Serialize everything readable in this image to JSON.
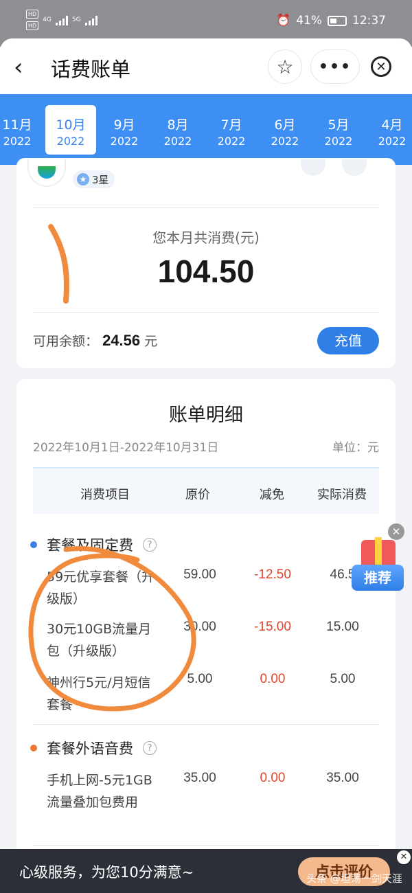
{
  "status_bar": {
    "hd1": "HD",
    "hd2": "HD",
    "net1": "4G",
    "net2": "5G",
    "battery": "41%",
    "time": "12:37"
  },
  "header": {
    "back_glyph": "‹",
    "title": "话费账单",
    "star_glyph": "☆",
    "more_glyph": "•••",
    "close_glyph": "✕"
  },
  "months": [
    {
      "month": "11月",
      "year": "2022"
    },
    {
      "month": "10月",
      "year": "2022",
      "active": true
    },
    {
      "month": "9月",
      "year": "2022"
    },
    {
      "month": "8月",
      "year": "2022"
    },
    {
      "month": "7月",
      "year": "2022"
    },
    {
      "month": "6月",
      "year": "2022"
    },
    {
      "month": "5月",
      "year": "2022"
    },
    {
      "month": "4月",
      "year": "2022"
    }
  ],
  "summary": {
    "star_level": "3星",
    "total_label": "您本月共消费(元)",
    "total_value": "104.50",
    "balance_label": "可用余额：",
    "balance_value": "24.56",
    "balance_unit": "元",
    "recharge_label": "充值"
  },
  "detail": {
    "title": "账单明细",
    "period": "2022年10月1日-2022年10月31日",
    "unit": "单位：元",
    "columns": [
      "消费项目",
      "原价",
      "减免",
      "实际消费"
    ],
    "categories": [
      {
        "name": "套餐及固定费",
        "dot_color": "#3e7fe6",
        "items": [
          {
            "name": "59元优享套餐（升级版）",
            "original": "59.00",
            "discount": "-12.50",
            "actual": "46.5"
          },
          {
            "name": "30元10GB流量月包（升级版）",
            "original": "30.00",
            "discount": "-15.00",
            "actual": "15.00"
          },
          {
            "name": "神州行5元/月短信套餐",
            "original": "5.00",
            "discount": "0.00",
            "actual": "5.00"
          }
        ]
      },
      {
        "name": "套餐外语音费",
        "dot_color": "#ee7733",
        "items": [
          {
            "name": "手机上网-5元1GB流量叠加包费用",
            "original": "35.00",
            "discount": "0.00",
            "actual": "35.00"
          }
        ]
      }
    ],
    "help_glyph": "?"
  },
  "recommend": {
    "label": "推荐",
    "close_glyph": "✕"
  },
  "banner": {
    "text": "心级服务，为您10分满意~",
    "button": "点击评价",
    "close_glyph": "✕",
    "watermark": "头条 @坦荡一剑天涯"
  },
  "colors": {
    "accent": "#3e8ff3",
    "discount_red": "#e0452f",
    "annotation": "#f08a3c"
  }
}
